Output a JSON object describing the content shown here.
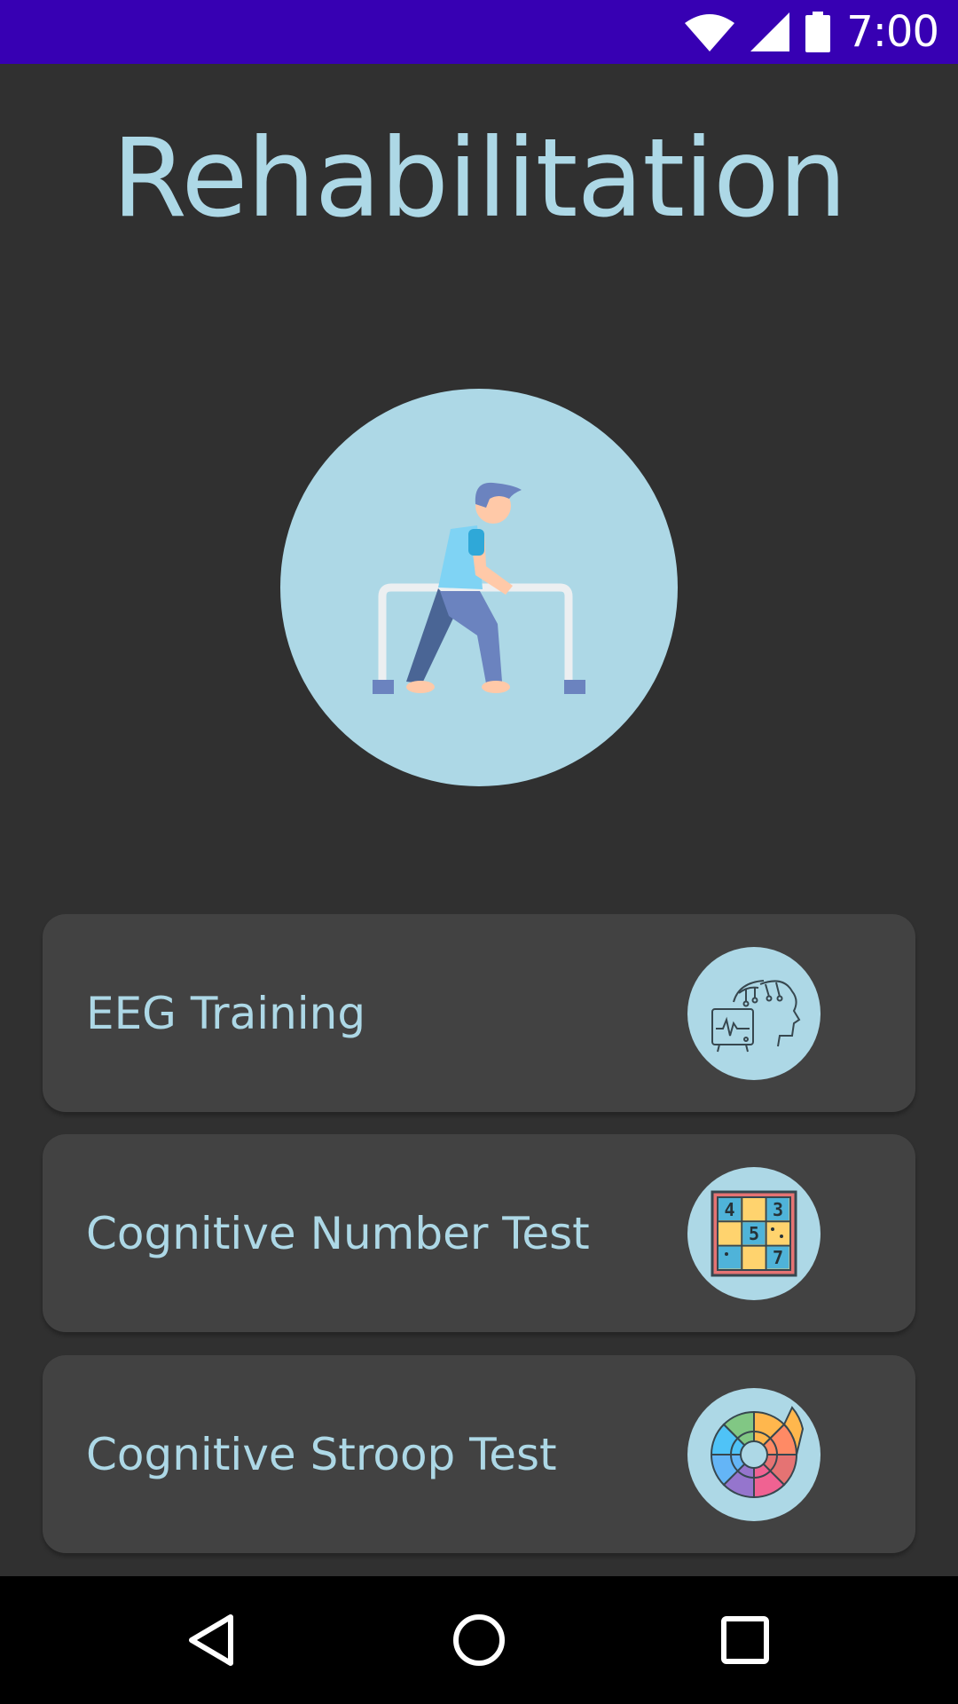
{
  "status_bar": {
    "time": "7:00",
    "icons": [
      "wifi-icon",
      "cell-signal-icon",
      "battery-icon"
    ],
    "color": "#3700B3"
  },
  "page": {
    "title": "Rehabilitation",
    "hero_icon": "rehabilitation-walker-icon"
  },
  "menu": [
    {
      "label": "EEG Training",
      "icon": "eeg-brain-monitor-icon"
    },
    {
      "label": "Cognitive Number Test",
      "icon": "number-grid-icon"
    },
    {
      "label": "Cognitive Stroop Test",
      "icon": "color-wheel-icon"
    }
  ],
  "nav_bar": {
    "buttons": [
      "back-icon",
      "home-icon",
      "recents-icon"
    ]
  },
  "colors": {
    "background": "#303030",
    "card": "#424242",
    "accent": "#ADD8E6"
  }
}
